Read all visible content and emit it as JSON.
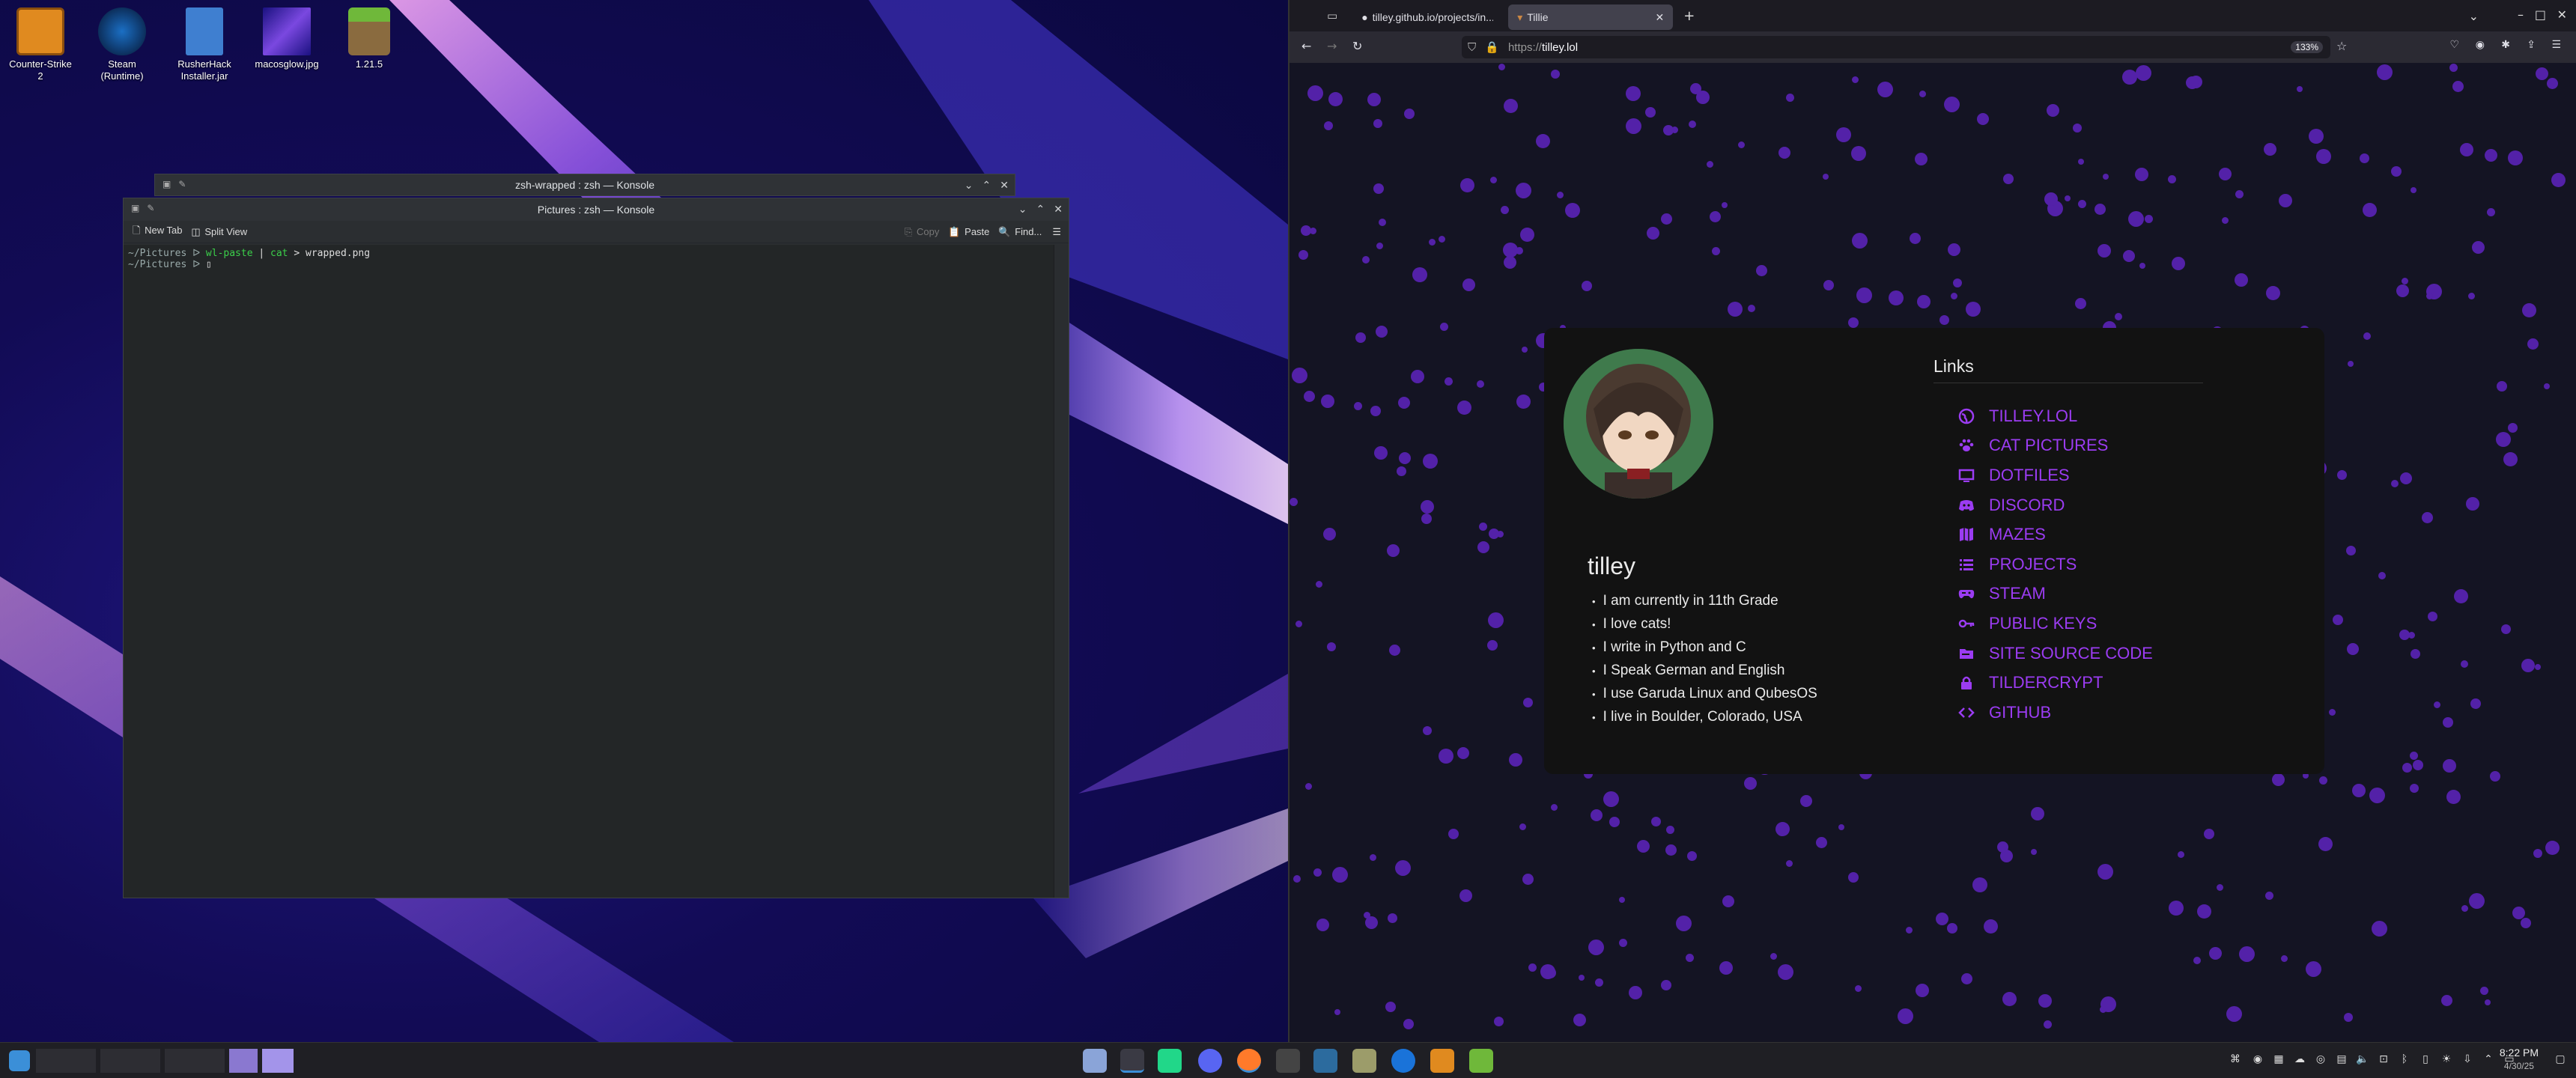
{
  "desktop": {
    "icons": [
      {
        "label": "Counter-Strike\n2",
        "icon": "counter-strike-icon"
      },
      {
        "label": "Steam\n(Runtime)",
        "icon": "steam-icon"
      },
      {
        "label": "RusherHack\nInstaller.jar",
        "icon": "jar-file-icon"
      },
      {
        "label": "macosglow.jpg",
        "icon": "image-file-icon"
      },
      {
        "label": "1.21.5",
        "icon": "minecraft-icon"
      }
    ]
  },
  "konsole_back": {
    "title": "zsh-wrapped : zsh — Konsole"
  },
  "konsole_front": {
    "title": "Pictures : zsh — Konsole",
    "toolbar": {
      "new_tab": "New Tab",
      "split_view": "Split View",
      "copy": "Copy",
      "paste": "Paste",
      "find": "Find..."
    },
    "lines": [
      {
        "prompt": "~/Pictures ᐅ",
        "cmd": "wl-paste",
        "pipe": "|",
        "cmd2": "cat",
        "rest": "> wrapped.png"
      },
      {
        "prompt": "~/Pictures ᐅ",
        "cursor": "▯"
      }
    ]
  },
  "browser": {
    "tabs": [
      {
        "label": "tilley.github.io/projects/in..."
      },
      {
        "label": "Tillie"
      }
    ],
    "url_prefix": "https://",
    "url_host": "tilley.lol",
    "zoom": "133%"
  },
  "site": {
    "name": "tilley",
    "facts": [
      "I am currently in 11th Grade",
      "I love cats!",
      "I write in Python and C",
      "I Speak German and English",
      "I use Garuda Linux and QubesOS",
      "I live in Boulder, Colorado, USA"
    ],
    "links_heading": "Links",
    "links": [
      {
        "label": "TILLEY.LOL",
        "icon": "globe-icon"
      },
      {
        "label": "CAT PICTURES",
        "icon": "paw-icon"
      },
      {
        "label": "DOTFILES",
        "icon": "monitor-icon"
      },
      {
        "label": "DISCORD",
        "icon": "discord-icon"
      },
      {
        "label": "MAZES",
        "icon": "map-icon"
      },
      {
        "label": "PROJECTS",
        "icon": "list-icon"
      },
      {
        "label": "STEAM",
        "icon": "gamepad-icon"
      },
      {
        "label": "PUBLIC KEYS",
        "icon": "key-icon"
      },
      {
        "label": "SITE SOURCE CODE",
        "icon": "file-code-icon"
      },
      {
        "label": "TILDERCRYPT",
        "icon": "lock-icon"
      },
      {
        "label": "GITHUB",
        "icon": "code-icon"
      }
    ],
    "accent": "#9b3cf2"
  },
  "taskbar": {
    "time": "8:22 PM",
    "date": "4/30/25"
  }
}
